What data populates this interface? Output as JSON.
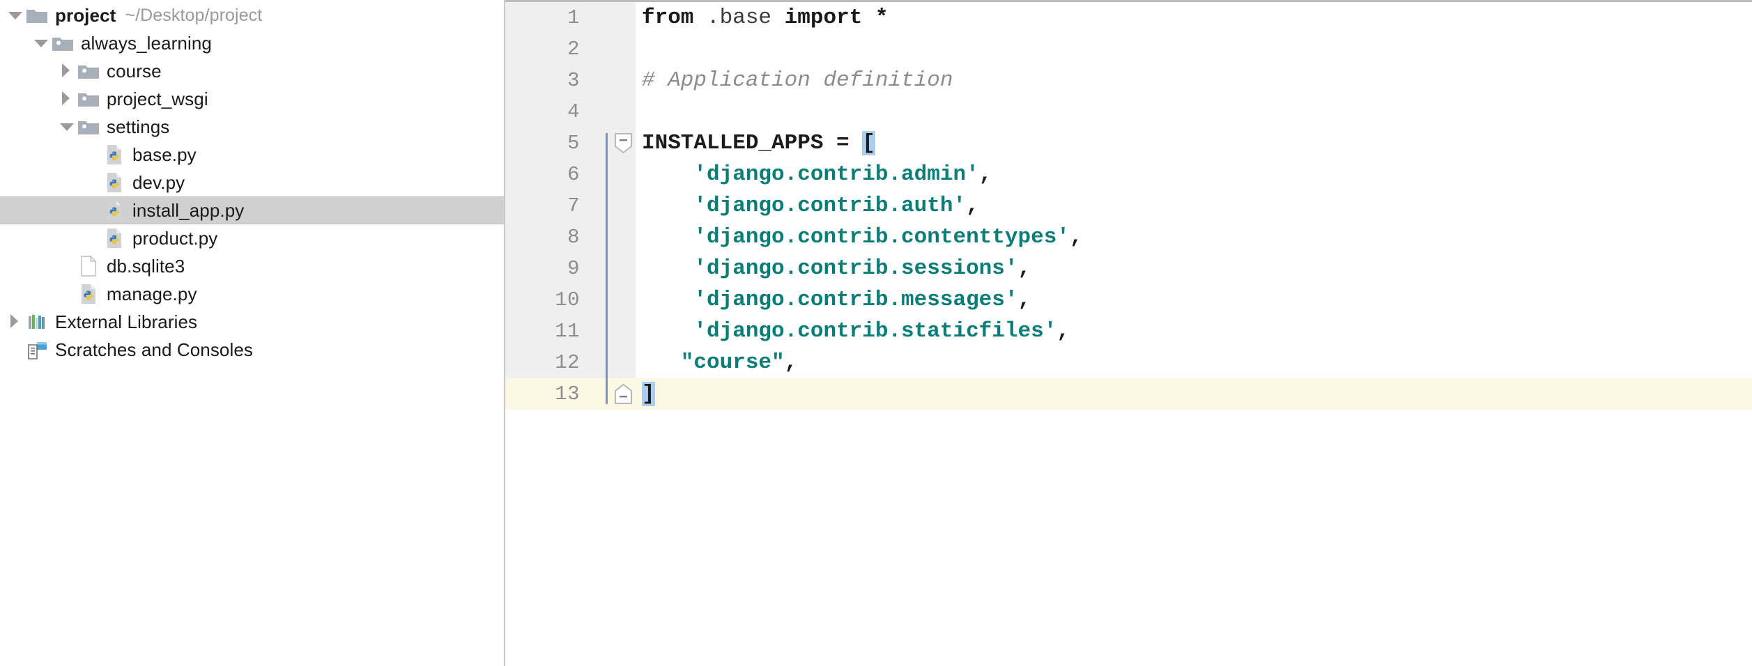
{
  "sidebar": {
    "name": "project-tree",
    "items": [
      {
        "label": "project",
        "hint": "~/Desktop/project",
        "depth": 0,
        "arrow": "down",
        "icon": "folder-icon",
        "bold": true,
        "selected": false
      },
      {
        "label": "always_learning",
        "hint": "",
        "depth": 1,
        "arrow": "down",
        "icon": "package-folder-icon",
        "bold": false,
        "selected": false
      },
      {
        "label": "course",
        "hint": "",
        "depth": 2,
        "arrow": "right",
        "icon": "package-folder-icon",
        "bold": false,
        "selected": false
      },
      {
        "label": "project_wsgi",
        "hint": "",
        "depth": 2,
        "arrow": "right",
        "icon": "package-folder-icon",
        "bold": false,
        "selected": false
      },
      {
        "label": "settings",
        "hint": "",
        "depth": 2,
        "arrow": "down",
        "icon": "package-folder-icon",
        "bold": false,
        "selected": false
      },
      {
        "label": "base.py",
        "hint": "",
        "depth": 3,
        "arrow": "none",
        "icon": "python-file-icon",
        "bold": false,
        "selected": false
      },
      {
        "label": "dev.py",
        "hint": "",
        "depth": 3,
        "arrow": "none",
        "icon": "python-file-icon",
        "bold": false,
        "selected": false
      },
      {
        "label": "install_app.py",
        "hint": "",
        "depth": 3,
        "arrow": "none",
        "icon": "python-file-icon",
        "bold": false,
        "selected": true
      },
      {
        "label": "product.py",
        "hint": "",
        "depth": 3,
        "arrow": "none",
        "icon": "python-file-icon",
        "bold": false,
        "selected": false
      },
      {
        "label": "db.sqlite3",
        "hint": "",
        "depth": 2,
        "arrow": "none",
        "icon": "blank-file-icon",
        "bold": false,
        "selected": false
      },
      {
        "label": "manage.py",
        "hint": "",
        "depth": 2,
        "arrow": "none",
        "icon": "python-file-icon",
        "bold": false,
        "selected": false
      },
      {
        "label": "External Libraries",
        "hint": "",
        "depth": 0,
        "arrow": "right",
        "icon": "library-icon",
        "bold": false,
        "selected": false
      },
      {
        "label": "Scratches and Consoles",
        "hint": "",
        "depth": 0,
        "arrow": "none",
        "icon": "scratches-icon",
        "bold": false,
        "selected": false
      }
    ]
  },
  "editor": {
    "file": "install_app.py",
    "language": "python",
    "current_line": 13,
    "selection_text": "[",
    "colors": {
      "string": "#0b7d77",
      "comment": "#8c8c8c",
      "keyword": "#1b1b1b",
      "selection": "#aacdf0",
      "current_line_bg": "#fdf8e4",
      "gutter_bg": "#efefef",
      "fold_line": "#7a96ba",
      "tree_selection": "#d0d0d0"
    },
    "lines": [
      {
        "n": "1",
        "fold": "none",
        "foldline": "none",
        "current": false,
        "tokens": [
          {
            "t": "kw",
            "v": "from"
          },
          {
            "t": "plain",
            "v": " .base "
          },
          {
            "t": "kw",
            "v": "import"
          },
          {
            "t": "plain",
            "v": " "
          },
          {
            "t": "punct",
            "v": "*"
          }
        ]
      },
      {
        "n": "2",
        "fold": "none",
        "foldline": "none",
        "current": false,
        "tokens": []
      },
      {
        "n": "3",
        "fold": "none",
        "foldline": "none",
        "current": false,
        "tokens": [
          {
            "t": "comment",
            "v": "# Application definition"
          }
        ]
      },
      {
        "n": "4",
        "fold": "none",
        "foldline": "none",
        "current": false,
        "tokens": []
      },
      {
        "n": "5",
        "fold": "open",
        "foldline": "start",
        "current": false,
        "tokens": [
          {
            "t": "kw",
            "v": "INSTALLED_APPS = "
          },
          {
            "t": "sel",
            "v": "["
          }
        ]
      },
      {
        "n": "6",
        "fold": "none",
        "foldline": "mid",
        "current": false,
        "tokens": [
          {
            "t": "str",
            "v": "    'django.contrib.admin'"
          },
          {
            "t": "punct",
            "v": ","
          }
        ]
      },
      {
        "n": "7",
        "fold": "none",
        "foldline": "mid",
        "current": false,
        "tokens": [
          {
            "t": "str",
            "v": "    'django.contrib.auth'"
          },
          {
            "t": "punct",
            "v": ","
          }
        ]
      },
      {
        "n": "8",
        "fold": "none",
        "foldline": "mid",
        "current": false,
        "tokens": [
          {
            "t": "str",
            "v": "    'django.contrib.contenttypes'"
          },
          {
            "t": "punct",
            "v": ","
          }
        ]
      },
      {
        "n": "9",
        "fold": "none",
        "foldline": "mid",
        "current": false,
        "tokens": [
          {
            "t": "str",
            "v": "    'django.contrib.sessions'"
          },
          {
            "t": "punct",
            "v": ","
          }
        ]
      },
      {
        "n": "10",
        "fold": "none",
        "foldline": "mid",
        "current": false,
        "tokens": [
          {
            "t": "str",
            "v": "    'django.contrib.messages'"
          },
          {
            "t": "punct",
            "v": ","
          }
        ]
      },
      {
        "n": "11",
        "fold": "none",
        "foldline": "mid",
        "current": false,
        "tokens": [
          {
            "t": "str",
            "v": "    'django.contrib.staticfiles'"
          },
          {
            "t": "punct",
            "v": ","
          }
        ]
      },
      {
        "n": "12",
        "fold": "none",
        "foldline": "mid",
        "current": false,
        "tokens": [
          {
            "t": "str",
            "v": "   \"course\""
          },
          {
            "t": "punct",
            "v": ","
          }
        ]
      },
      {
        "n": "13",
        "fold": "close",
        "foldline": "end",
        "current": true,
        "tokens": [
          {
            "t": "sel",
            "v": "]"
          }
        ]
      }
    ]
  }
}
